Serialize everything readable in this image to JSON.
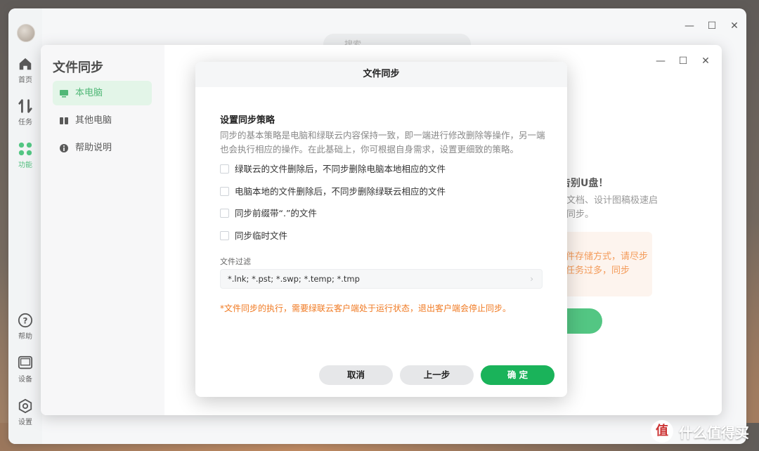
{
  "app": {
    "search_placeholder": "搜索",
    "nav": {
      "home": "首页",
      "tasks": "任务",
      "features": "功能",
      "help": "帮助",
      "device": "设备",
      "settings": "设置"
    }
  },
  "sync_window": {
    "title": "文件同步",
    "sidebar": [
      {
        "label": "本电脑",
        "icon": "monitor-icon"
      },
      {
        "label": "其他电脑",
        "icon": "devices-icon"
      },
      {
        "label": "帮助说明",
        "icon": "info-icon"
      }
    ],
    "background": {
      "headline": "告别U盘！",
      "text": "文档、设计图稿极速启同步。",
      "warning": "件存储方式，请尽步任务过多，同步"
    }
  },
  "dialog": {
    "title": "文件同步",
    "section_title": "设置同步策略",
    "description": "同步的基本策略是电脑和绿联云内容保持一致，即一端进行修改删除等操作，另一端也会执行相应的操作。在此基础上，你可根据自身需求，设置更细致的策略。",
    "options": [
      {
        "label": "绿联云的文件删除后，不同步删除电脑本地相应的文件",
        "checked": false
      },
      {
        "label": "电脑本地的文件删除后，不同步删除绿联云相应的文件",
        "checked": false
      },
      {
        "label": "同步前缀带“.”的文件",
        "checked": false
      },
      {
        "label": "同步临时文件",
        "checked": false
      }
    ],
    "filter_label": "文件过滤",
    "filter_value": "*.lnk; *.pst; *.swp; *.temp; *.tmp",
    "note": "*文件同步的执行，需要绿联云客户端处于运行状态，退出客户端会停止同步。",
    "buttons": {
      "cancel": "取消",
      "back": "上一步",
      "confirm": "确 定"
    }
  },
  "watermark": {
    "logo": "值",
    "text": "什么值得买"
  },
  "colors": {
    "accent": "#1ab35a",
    "warning": "#f07a23"
  }
}
